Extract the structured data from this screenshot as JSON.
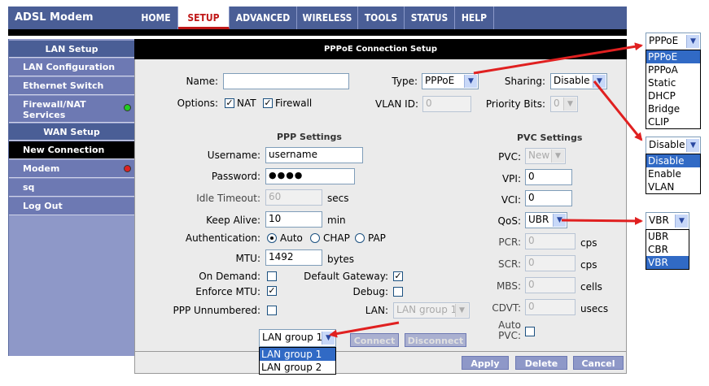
{
  "brand": "ADSL Modem",
  "nav": {
    "tabs": [
      "HOME",
      "SETUP",
      "ADVANCED",
      "WIRELESS",
      "TOOLS",
      "STATUS",
      "HELP"
    ],
    "active": "SETUP"
  },
  "sidebar": {
    "lan_setup": "LAN Setup",
    "lan_configuration": "LAN Configuration",
    "ethernet_switch": "Ethernet Switch",
    "firewall_nat": "Firewall/NAT Services",
    "wan_setup": "WAN Setup",
    "new_connection": "New Connection",
    "modem": "Modem",
    "sq": "sq",
    "log_out": "Log Out",
    "colors": {
      "green_dot": "#22cc22",
      "red_dot": "#dd2222",
      "active_bg": "#000000"
    }
  },
  "form": {
    "title": "PPPoE Connection Setup",
    "name_label": "Name:",
    "name_value": "",
    "type_label": "Type:",
    "type_value": "PPPoE",
    "sharing_label": "Sharing:",
    "sharing_value": "Disable",
    "options_label": "Options:",
    "nat_label": "NAT",
    "firewall_label": "Firewall",
    "vlan_id_label": "VLAN ID:",
    "vlan_id_value": "0",
    "priority_bits_label": "Priority Bits:",
    "priority_bits_value": "0",
    "ppp_settings": "PPP Settings",
    "username_label": "Username:",
    "username_value": "username",
    "password_label": "Password:",
    "password_value": "●●●●",
    "idle_timeout_label": "Idle Timeout:",
    "idle_timeout_value": "60",
    "idle_timeout_unit": "secs",
    "keep_alive_label": "Keep Alive:",
    "keep_alive_value": "10",
    "keep_alive_unit": "min",
    "authentication_label": "Authentication:",
    "auth_auto": "Auto",
    "auth_chap": "CHAP",
    "auth_pap": "PAP",
    "mtu_label": "MTU:",
    "mtu_value": "1492",
    "mtu_unit": "bytes",
    "on_demand_label": "On Demand:",
    "default_gateway_label": "Default Gateway:",
    "enforce_mtu_label": "Enforce MTU:",
    "debug_label": "Debug:",
    "ppp_unnumbered_label": "PPP Unnumbered:",
    "lan_label": "LAN:",
    "lan_value": "LAN group 1",
    "pvc_settings": "PVC Settings",
    "pvc_label": "PVC:",
    "pvc_value": "New",
    "vpi_label": "VPI:",
    "vpi_value": "0",
    "vci_label": "VCI:",
    "vci_value": "0",
    "qos_label": "QoS:",
    "qos_value": "UBR",
    "pcr_label": "PCR:",
    "pcr_value": "0",
    "pcr_unit": "cps",
    "scr_label": "SCR:",
    "scr_value": "0",
    "scr_unit": "cps",
    "mbs_label": "MBS:",
    "mbs_value": "0",
    "mbs_unit": "cells",
    "cdvt_label": "CDVT:",
    "cdvt_value": "0",
    "cdvt_unit": "usecs",
    "auto_pvc_label_1": "Auto",
    "auto_pvc_label_2": "PVC:",
    "connect": "Connect",
    "disconnect": "Disconnect",
    "apply": "Apply",
    "delete": "Delete",
    "cancel": "Cancel"
  },
  "callouts": {
    "type": {
      "value": "PPPoE",
      "options": [
        "PPPoE",
        "PPPoA",
        "Static",
        "DHCP",
        "Bridge",
        "CLIP"
      ],
      "highlighted": 0
    },
    "sharing": {
      "value": "Disable",
      "options": [
        "Disable",
        "Enable",
        "VLAN"
      ],
      "highlighted": 0
    },
    "qos": {
      "value": "VBR",
      "options": [
        "UBR",
        "CBR",
        "VBR"
      ],
      "highlighted": 2
    },
    "lan": {
      "value": "LAN group 1",
      "options": [
        "LAN group 1",
        "LAN group 2"
      ],
      "highlighted": 0
    },
    "arrow_color": "#e02020"
  }
}
